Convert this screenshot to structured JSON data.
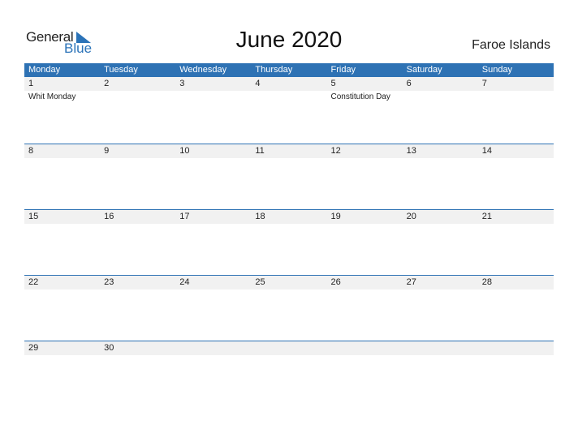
{
  "logo": {
    "part1": "General",
    "part2": "Blue"
  },
  "title": "June 2020",
  "country": "Faroe Islands",
  "weekdays": [
    "Monday",
    "Tuesday",
    "Wednesday",
    "Thursday",
    "Friday",
    "Saturday",
    "Sunday"
  ],
  "weeks": [
    {
      "days": [
        "1",
        "2",
        "3",
        "4",
        "5",
        "6",
        "7"
      ],
      "holidays": [
        "Whit Monday",
        "",
        "",
        "",
        "Constitution Day",
        "",
        ""
      ]
    },
    {
      "days": [
        "8",
        "9",
        "10",
        "11",
        "12",
        "13",
        "14"
      ],
      "holidays": [
        "",
        "",
        "",
        "",
        "",
        "",
        ""
      ]
    },
    {
      "days": [
        "15",
        "16",
        "17",
        "18",
        "19",
        "20",
        "21"
      ],
      "holidays": [
        "",
        "",
        "",
        "",
        "",
        "",
        ""
      ]
    },
    {
      "days": [
        "22",
        "23",
        "24",
        "25",
        "26",
        "27",
        "28"
      ],
      "holidays": [
        "",
        "",
        "",
        "",
        "",
        "",
        ""
      ]
    },
    {
      "days": [
        "29",
        "30",
        "",
        "",
        "",
        "",
        ""
      ],
      "holidays": [
        "",
        "",
        "",
        "",
        "",
        "",
        ""
      ]
    }
  ]
}
